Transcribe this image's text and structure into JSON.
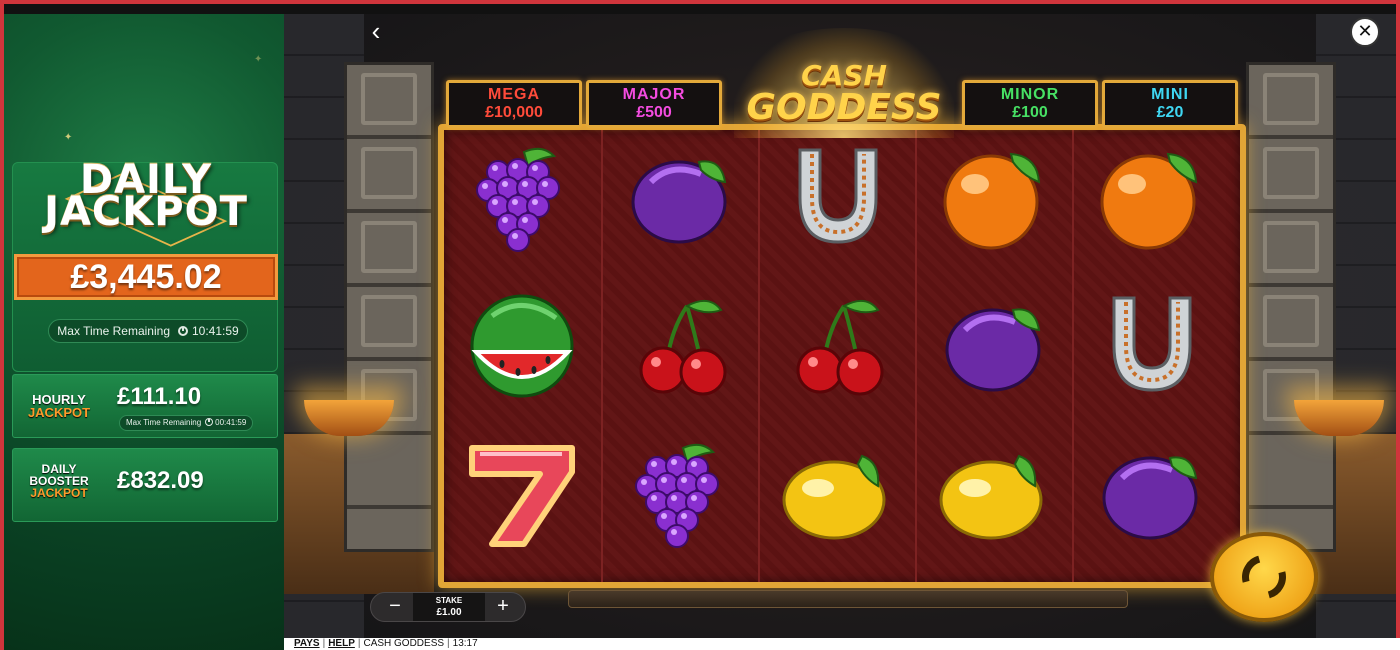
{
  "sidebar": {
    "daily_jackpot": {
      "title_line1": "DAILY",
      "title_line2": "JACKPOT",
      "amount": "£3,445.02",
      "timer_label": "Max Time Remaining",
      "timer_value": "10:41:59"
    },
    "hourly_jackpot": {
      "label_line1": "HOURLY",
      "label_line2": "JACKPOT",
      "amount": "£111.10",
      "timer_label": "Max Time Remaining",
      "timer_value": "00:41:59"
    },
    "daily_booster_jackpot": {
      "label_line1": "DAILY",
      "label_line2": "BOOSTER",
      "label_line3": "JACKPOT",
      "amount": "£832.09"
    }
  },
  "game": {
    "title_line1": "CASH",
    "title_line2": "GODDESS",
    "back_icon": "chevron-left-icon",
    "close_icon": "close-icon",
    "jackpots": [
      {
        "name": "MEGA",
        "amount": "£10,000",
        "color": "#ff4b3a"
      },
      {
        "name": "MAJOR",
        "amount": "£500",
        "color": "#f44ce0"
      },
      {
        "name": "MINOR",
        "amount": "£100",
        "color": "#47e064"
      },
      {
        "name": "MINI",
        "amount": "£20",
        "color": "#3fd7f2"
      }
    ],
    "reels": [
      [
        "grapes",
        "watermelon",
        "seven"
      ],
      [
        "plum",
        "cherries",
        "grapes"
      ],
      [
        "horseshoe",
        "cherries",
        "lemon"
      ],
      [
        "orange",
        "plum",
        "lemon"
      ],
      [
        "orange",
        "horseshoe",
        "plum"
      ]
    ],
    "stake": {
      "label": "STAKE",
      "value": "£1.00",
      "minus": "−",
      "plus": "+"
    },
    "spin_icon": "spin-icon"
  },
  "footer": {
    "pays": "PAYS",
    "help": "HELP",
    "game_name": "CASH GODDESS",
    "time": "13:17",
    "separator": "|"
  }
}
